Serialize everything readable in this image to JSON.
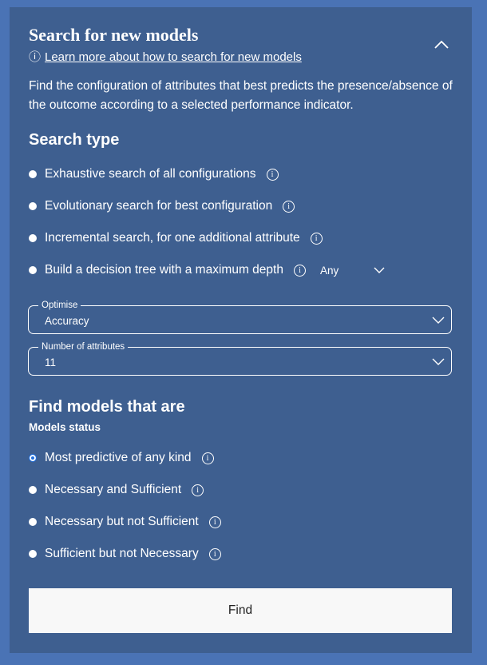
{
  "header": {
    "title": "Search for new models",
    "info_symbol": "ⓘ",
    "learn_more_link": "Learn more about how to search for new models"
  },
  "description": "Find the configuration of attributes that best predicts the presence/absence of the outcome according to a selected performance indicator.",
  "search_type": {
    "heading": "Search type",
    "options": [
      {
        "label": "Exhaustive search of all configurations",
        "selected": false
      },
      {
        "label": "Evolutionary search for best configuration",
        "selected": false
      },
      {
        "label": "Incremental search, for one additional attribute",
        "selected": false
      },
      {
        "label": "Build a decision tree with a maximum depth",
        "selected": false
      }
    ],
    "depth_value": "Any"
  },
  "optimise": {
    "caption": "Optimise",
    "value": "Accuracy"
  },
  "num_attributes": {
    "caption": "Number of attributes",
    "value": "11"
  },
  "find_models": {
    "heading": "Find models that are",
    "subheading": "Models status",
    "options": [
      {
        "label": "Most predictive of any kind",
        "selected": true
      },
      {
        "label": "Necessary and Sufficient",
        "selected": false
      },
      {
        "label": "Necessary but not Sufficient",
        "selected": false
      },
      {
        "label": "Sufficient but not Necessary",
        "selected": false
      }
    ]
  },
  "find_button": "Find",
  "colors": {
    "page_bg": "#4a73b5",
    "panel_bg": "#3e5f90",
    "accent": "#1f6fde",
    "button_bg": "#f8f8f8"
  },
  "icons": {
    "info": "info-icon",
    "collapse": "chevron-up-icon",
    "dropdown": "chevron-down-icon"
  }
}
